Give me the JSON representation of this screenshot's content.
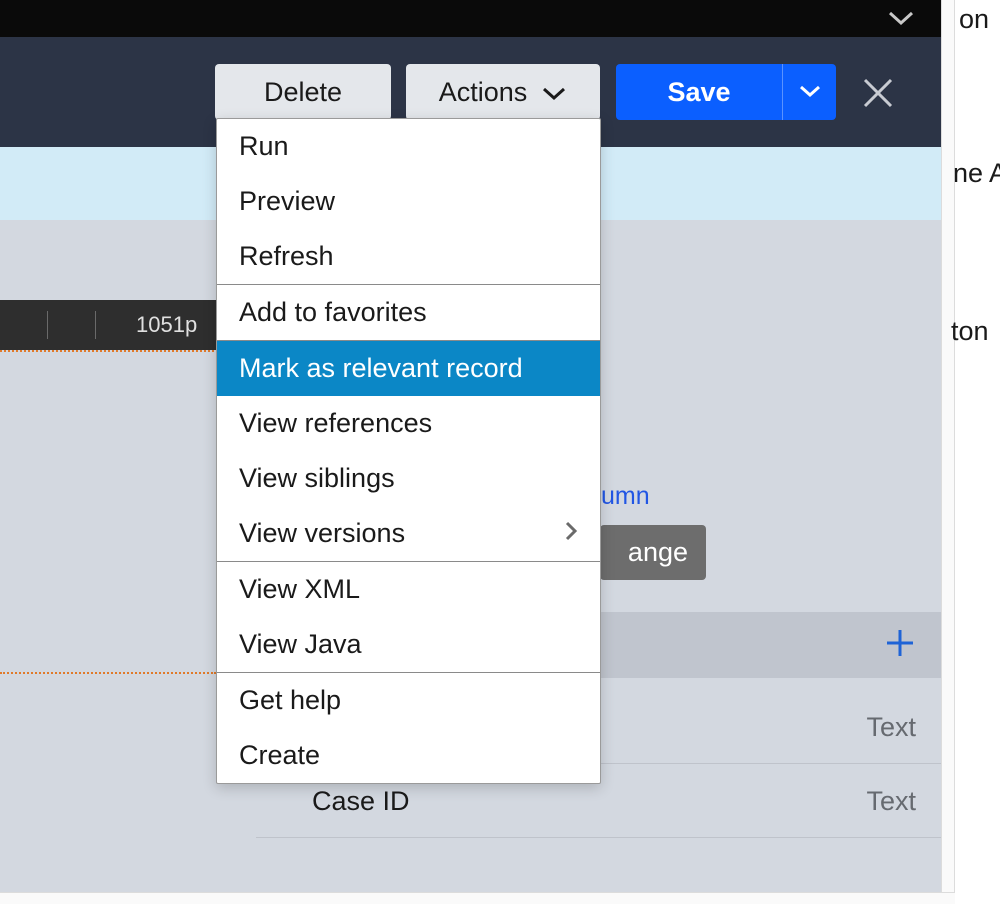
{
  "toolbar": {
    "delete_label": "Delete",
    "actions_label": "Actions",
    "save_label": "Save"
  },
  "ruler": {
    "value_label": "1051p"
  },
  "link_fragment": "umn",
  "change_button_fragment": "ange",
  "dropdown": {
    "items": [
      {
        "label": "Run"
      },
      {
        "label": "Preview"
      },
      {
        "label": "Refresh"
      },
      {
        "label": "Add to favorites"
      },
      {
        "label": "Mark as relevant record",
        "selected": true
      },
      {
        "label": "View references"
      },
      {
        "label": "View siblings"
      },
      {
        "label": "View versions",
        "submenu": true
      },
      {
        "label": "View XML"
      },
      {
        "label": "View Java"
      },
      {
        "label": "Get help"
      },
      {
        "label": "Create"
      }
    ],
    "separators_after": [
      2,
      3,
      7,
      9
    ]
  },
  "rows": [
    {
      "label": "",
      "type": "Text"
    },
    {
      "label": "Case ID",
      "type": "Text"
    }
  ],
  "background_fragments": {
    "a": "on",
    "b": "ne A",
    "c": "ton"
  }
}
